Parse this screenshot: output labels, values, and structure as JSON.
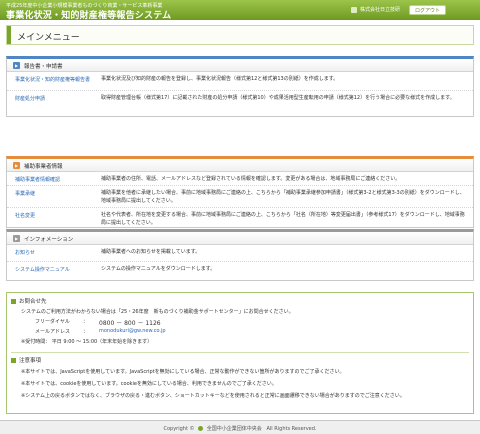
{
  "header": {
    "subtitle": "平成25年度中小企業小規模事業者ものづくり商業・サービス革新事業",
    "title": "事業化状況・知的財産権等報告システム",
    "user_name": "株式会社日立技研",
    "logout_label": "ログアウト"
  },
  "page_title": "メインメニュー",
  "sections": [
    {
      "title": "報告書・申請書",
      "rows": [
        {
          "label": "事業化状況・知的財産権等報告書",
          "desc": "事業化状況及び知的財産の報告を登録し、事業化状況報告（様式第12と様式第13の別紙）を作成します。"
        },
        {
          "label": "財産処分申請",
          "desc": "取得財産管理台帳（様式第17）に記載された財産の処分申請（様式第10）や成果活用型生産転用の申請（様式第12）を行う場合に必要な様式を作成します。"
        }
      ]
    },
    {
      "title": "補助事業者情報",
      "rows": [
        {
          "label": "補助事業者情報確認",
          "desc": "補助事業者の住所、電話、メールアドレスなど登録されている情報を確認します。変更がある場合は、地域事務局にご連絡ください。"
        },
        {
          "label": "事業承継",
          "desc": "補助事業を他者に承継したい場合、事前に地域事務局にご連絡の上、こちらから「補助事業承継参加申請書」（様式第3-2と様式第3-3の別紙）をダウンロードし、地域事務局に提出してください。"
        },
        {
          "label": "社名変更",
          "desc": "社名や代表者、所在地を変更する場合、事前に地域事務局にご連絡の上、こちらから「社名（所在地）等変更届出書」（参考様式17）をダウンロードし、地域事務局に提出してください。"
        }
      ]
    },
    {
      "title": "インフォメーション",
      "rows": [
        {
          "label": "お知らせ",
          "desc": "補助事業者へのお知らせを掲載しています。"
        },
        {
          "label": "システム操作マニュアル",
          "desc": "システムの操作マニュアルをダウンロードします。"
        }
      ]
    }
  ],
  "contact": {
    "title": "お問合せ先",
    "intro": "システムのご利用方法がわからない場合は「25・26年度　新ものづくり補助金サポートセンター」にお問合せください。",
    "phone_label": "フリーダイヤル",
    "phone": "0800 － 800 － 1126",
    "mail_label": "メールアドレス",
    "mail": "monodukuri@gw.new.co.jp",
    "hours": "※受付時間： 平日 9:00 ～ 15:00（年末年始を除きます）"
  },
  "notes": {
    "title": "注意事項",
    "items": [
      "本サイトでは、JavaScriptを使用しています。JavaScriptを無効にしている場合、正常な動作ができない箇所がありますのでご了承ください。",
      "本サイトでは、cookieを使用しています。cookieを無効にしている場合、利用できませんのでご了承ください。",
      "システム上の戻るボタンではなく、ブラウザの戻る・進むボタン、ショートカットキーなどを使用されると正常に画面遷移できない場合がありますのでご注意ください。"
    ]
  },
  "footer": {
    "copyright": "Copyright ©",
    "org": "全国中小企業団体中央会",
    "rights": "All Rights Reserved."
  },
  "colors": {
    "header_green": "#7aa52a",
    "section_blue": "#4f86c6",
    "section_orange": "#e58d3c",
    "section_gray": "#9a9a9a",
    "link_blue": "#2a68b5"
  }
}
